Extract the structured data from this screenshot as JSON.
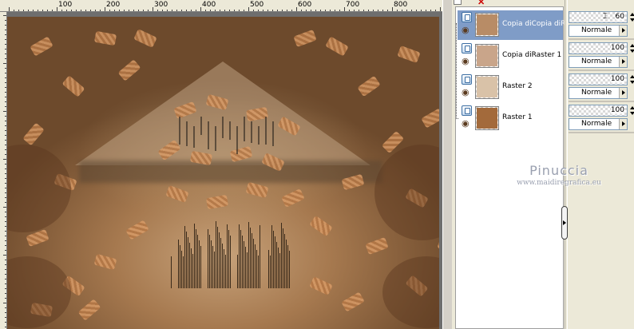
{
  "ruler": {
    "top_labels": [
      "100",
      "200",
      "300",
      "400",
      "500",
      "600",
      "700",
      "800"
    ]
  },
  "canvas": {
    "description_colors": {
      "sand": "#c7a27a",
      "bronze": "#a6794f",
      "dark": "#6d4a2c",
      "leaf": "#d79a66"
    }
  },
  "layers": [
    {
      "name": "Copia diCopia diR",
      "opacity": "60",
      "blend": "Normale",
      "selected": true,
      "thumb_color": "#b88c66"
    },
    {
      "name": "Copia diRaster 1",
      "opacity": "100",
      "blend": "Normale",
      "selected": false,
      "thumb_color": "#c9a58a"
    },
    {
      "name": "Raster 2",
      "opacity": "100",
      "blend": "Normale",
      "selected": false,
      "thumb_color": "#d9c2a8"
    },
    {
      "name": "Raster 1",
      "opacity": "100",
      "blend": "Normale",
      "selected": false,
      "thumb_color": "#a36a3b"
    }
  ],
  "toolbar": {
    "delete_glyph": "✕"
  },
  "watermark": {
    "name": "Pinuccia",
    "url": "www.maidiregrafica.eu"
  },
  "colors": {
    "selection": "#7f9cc7",
    "panel_bg": "#ece9d8"
  }
}
